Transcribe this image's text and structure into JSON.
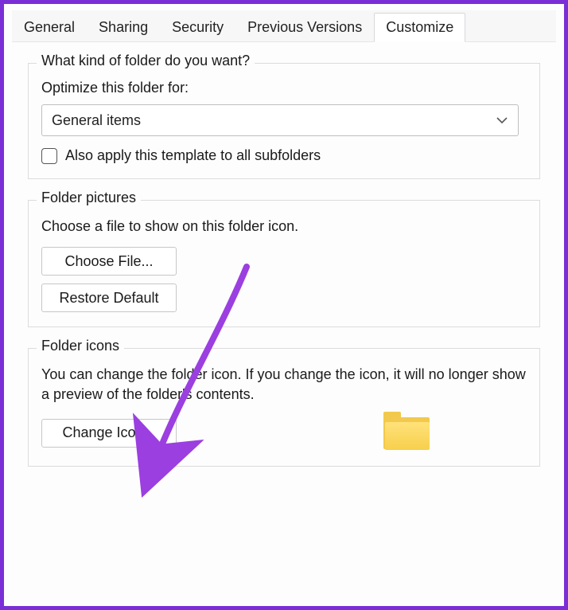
{
  "tabs": [
    {
      "label": "General"
    },
    {
      "label": "Sharing"
    },
    {
      "label": "Security"
    },
    {
      "label": "Previous Versions"
    },
    {
      "label": "Customize",
      "active": true
    }
  ],
  "group_folder_type": {
    "title": "What kind of folder do you want?",
    "optimize_label": "Optimize this folder for:",
    "dropdown_value": "General items",
    "apply_subfolders_label": "Also apply this template to all subfolders"
  },
  "group_folder_pictures": {
    "title": "Folder pictures",
    "desc": "Choose a file to show on this folder icon.",
    "choose_file_label": "Choose File...",
    "restore_default_label": "Restore Default"
  },
  "group_folder_icons": {
    "title": "Folder icons",
    "desc": "You can change the folder icon. If you change the icon, it will no longer show a preview of the folder's contents.",
    "change_icon_label": "Change Icon..."
  }
}
